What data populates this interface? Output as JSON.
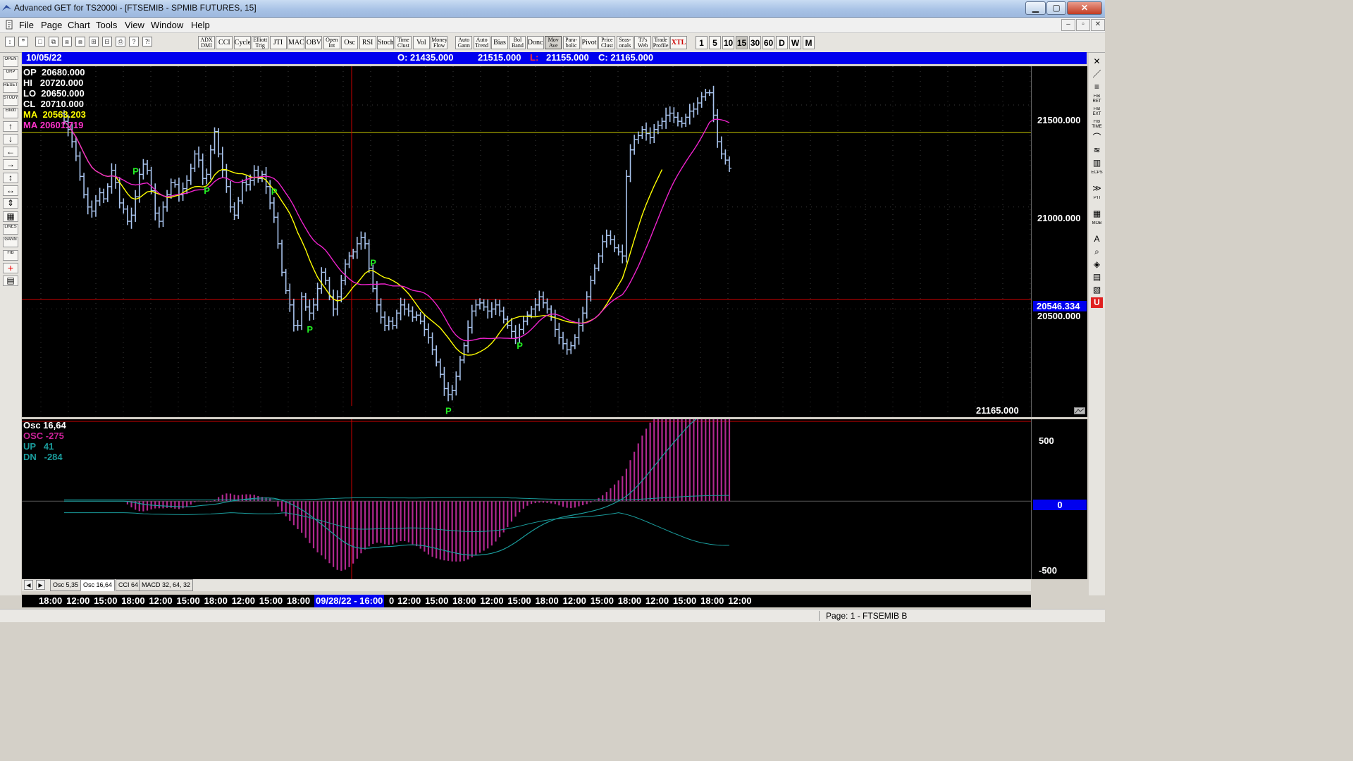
{
  "window": {
    "title": "Advanced GET for TS2000i - [FTSEMIB - SPMIB FUTURES, 15]",
    "controls": {
      "minimize": "▁",
      "maximize": "▢",
      "close": "✕"
    }
  },
  "menu": [
    "File",
    "Page",
    "Chart",
    "Tools",
    "View",
    "Window",
    "Help"
  ],
  "mdi_controls": [
    "‒",
    "▫",
    "✕"
  ],
  "toolbar": {
    "small_icons": [
      "pointer-icon",
      "quote-icon",
      "new-page-icon",
      "copy-icon",
      "paste-icon",
      "print-preview-icon",
      "grid-icon",
      "multi-icon",
      "print-icon",
      "tip-icon",
      "help-cursor-icon"
    ],
    "studies": [
      [
        "ADX",
        "DMI"
      ],
      [
        "CCI"
      ],
      [
        "Cycles"
      ],
      [
        "Elliott",
        "Trig"
      ],
      [
        "JTI"
      ],
      [
        "MACD"
      ],
      [
        "OBV"
      ],
      [
        "Open",
        "Int"
      ],
      [
        "Osc"
      ],
      [
        "RSI"
      ],
      [
        "Stoch"
      ],
      [
        "Time",
        "Clust"
      ],
      [
        "Vol"
      ],
      [
        "Money",
        "Flow"
      ],
      [
        "Auto",
        "Gann"
      ],
      [
        "Auto",
        "Trend"
      ],
      [
        "Bias"
      ],
      [
        "Bol",
        "Band"
      ],
      [
        "Donch"
      ],
      [
        "Mov",
        "Ave"
      ],
      [
        "Para-",
        "bolic"
      ],
      [
        "Pivot"
      ],
      [
        "Price",
        "Clust"
      ],
      [
        "Seas-",
        "onals"
      ],
      [
        "TJ's",
        "Web"
      ],
      [
        "Trade",
        "Profile"
      ],
      [
        "XTL"
      ]
    ],
    "frames": [
      "1",
      "5",
      "10",
      "15",
      "30",
      "60",
      "D",
      "W",
      "M"
    ],
    "selected_frame": "15"
  },
  "left_tools": [
    "OPEN",
    "GRP",
    "RESET",
    "STUDY",
    "Elliott",
    "↑",
    "↓",
    "←",
    "→",
    "↕",
    "↔",
    "⇕",
    "▦",
    "LINES",
    "GANN",
    "FIB",
    "+",
    "▤"
  ],
  "right_tools": [
    "✕",
    "／",
    "≡",
    "FIB RET",
    "FIB EXT",
    "FIB TIME",
    "⌒",
    "≋",
    "▥",
    "ECPS",
    "≫",
    "PTI",
    "▦",
    "MOB",
    "A",
    "⌕",
    "◈",
    "▤",
    "▧",
    "U"
  ],
  "info_bar": {
    "date": "10/05/22",
    "open": "O: 21435.000",
    "high": "21515.000",
    "low_label": "L:",
    "low_value": "21155.000",
    "close": "C: 21165.000"
  },
  "price_overlay": [
    {
      "label": "OP",
      "value": "20680.000",
      "color": "#ffffff"
    },
    {
      "label": "HI",
      "value": "20720.000",
      "color": "#ffffff"
    },
    {
      "label": "LO",
      "value": "20650.000",
      "color": "#ffffff"
    },
    {
      "label": "CL",
      "value": "20710.000",
      "color": "#ffffff"
    },
    {
      "label": "MA",
      "value": "20563.203",
      "color": "#ffff00"
    },
    {
      "label": "MA",
      "value": "20601.719",
      "color": "#ff33cc"
    }
  ],
  "price_axis": {
    "ticks": [
      "21500.000",
      "21000.000",
      "20500.000"
    ],
    "current_value": "20546.334",
    "last_value": "21165.000"
  },
  "pivot_marker_label": "P",
  "osc_overlay": {
    "title": "Osc 16,64",
    "lines": [
      {
        "label": "OSC",
        "value": "-275",
        "color": "#cc2299"
      },
      {
        "label": "UP",
        "value": "41",
        "color": "#1a9c9c"
      },
      {
        "label": "DN",
        "value": "-284",
        "color": "#1a9c9c"
      }
    ]
  },
  "osc_axis": {
    "ticks": [
      "500",
      "-500"
    ],
    "zero": "0"
  },
  "tabs": [
    "Osc 5,35",
    "Osc 16,64",
    "CCI 64",
    "MACD 32, 64, 32"
  ],
  "active_tab": "Osc 16,64",
  "time_axis": {
    "labels_left": [
      "18:00",
      "12:00",
      "15:00",
      "18:00",
      "12:00",
      "15:00",
      "18:00",
      "12:00",
      "15:00",
      "18:00"
    ],
    "highlight": "09/28/22 - 16:00",
    "labels_right": [
      "0",
      "12:00",
      "15:00",
      "18:00",
      "12:00",
      "15:00",
      "18:00",
      "12:00",
      "15:00",
      "18:00",
      "12:00",
      "15:00",
      "18:00",
      "12:00"
    ]
  },
  "status": "Page: 1 - FTSEMIB B",
  "colors": {
    "bars": "#a9c4ee",
    "ma1": "#ffff00",
    "ma2": "#ee22cc",
    "hist": "#b0288f",
    "osc_line": "#1a9c9c",
    "pivot": "#22ee22",
    "ref_line_yellow": "#c8c800",
    "ref_line_red": "#cc0000",
    "info_blue": "#0000ee"
  },
  "chart_data": {
    "type": "line",
    "title": "FTSEMIB - SPMIB FUTURES, 15",
    "ylim": [
      19970,
      21690
    ],
    "reference_lines": {
      "yellow": 21365,
      "red": 20546.334
    },
    "closes": [
      21420,
      21380,
      21320,
      21250,
      21150,
      21060,
      21000,
      20980,
      21030,
      21070,
      21040,
      21100,
      21180,
      21120,
      21020,
      20990,
      20930,
      20960,
      21050,
      21160,
      21210,
      21180,
      21080,
      20970,
      20930,
      21000,
      21060,
      21120,
      21110,
      21060,
      21090,
      21130,
      21190,
      21260,
      21230,
      21140,
      21160,
      21280,
      21370,
      21260,
      21180,
      21100,
      21000,
      20960,
      21030,
      21120,
      21110,
      21130,
      21180,
      21140,
      21160,
      21100,
      21020,
      20950,
      20820,
      20680,
      20590,
      20520,
      20420,
      20420,
      20560,
      20510,
      20480,
      20520,
      20600,
      20680,
      20640,
      20560,
      20500,
      20560,
      20640,
      20720,
      20760,
      20780,
      20820,
      20850,
      20820,
      20700,
      20600,
      20520,
      20460,
      20420,
      20440,
      20420,
      20480,
      20520,
      20500,
      20490,
      20460,
      20470,
      20440,
      20400,
      20360,
      20300,
      20240,
      20180,
      20110,
      20080,
      20100,
      20170,
      20250,
      20320,
      20410,
      20490,
      20520,
      20530,
      20510,
      20490,
      20500,
      20520,
      20490,
      20450,
      20420,
      20390,
      20360,
      20400,
      20440,
      20470,
      20500,
      20520,
      20560,
      20530,
      20500,
      20460,
      20400,
      20360,
      20330,
      20300,
      20320,
      20360,
      20420,
      20480,
      20560,
      20640,
      20700,
      20760,
      20830,
      20860,
      20840,
      20800,
      20780,
      20760,
      21150,
      21280,
      21330,
      21350,
      21380,
      21360,
      21340,
      21380,
      21400,
      21420,
      21450,
      21460,
      21440,
      21420,
      21410,
      21440,
      21470,
      21480,
      21510,
      21540,
      21560,
      21560,
      21450,
      21320,
      21260,
      21230,
      21190
    ],
    "osc_ylim": [
      -610,
      640
    ],
    "pivots": [
      {
        "bar": 18,
        "type": "high"
      },
      {
        "bar": 36,
        "type": "low"
      },
      {
        "bar": 53,
        "type": "high"
      },
      {
        "bar": 62,
        "type": "low"
      },
      {
        "bar": 78,
        "type": "high"
      },
      {
        "bar": 97,
        "type": "low"
      },
      {
        "bar": 115,
        "type": "low"
      }
    ]
  }
}
